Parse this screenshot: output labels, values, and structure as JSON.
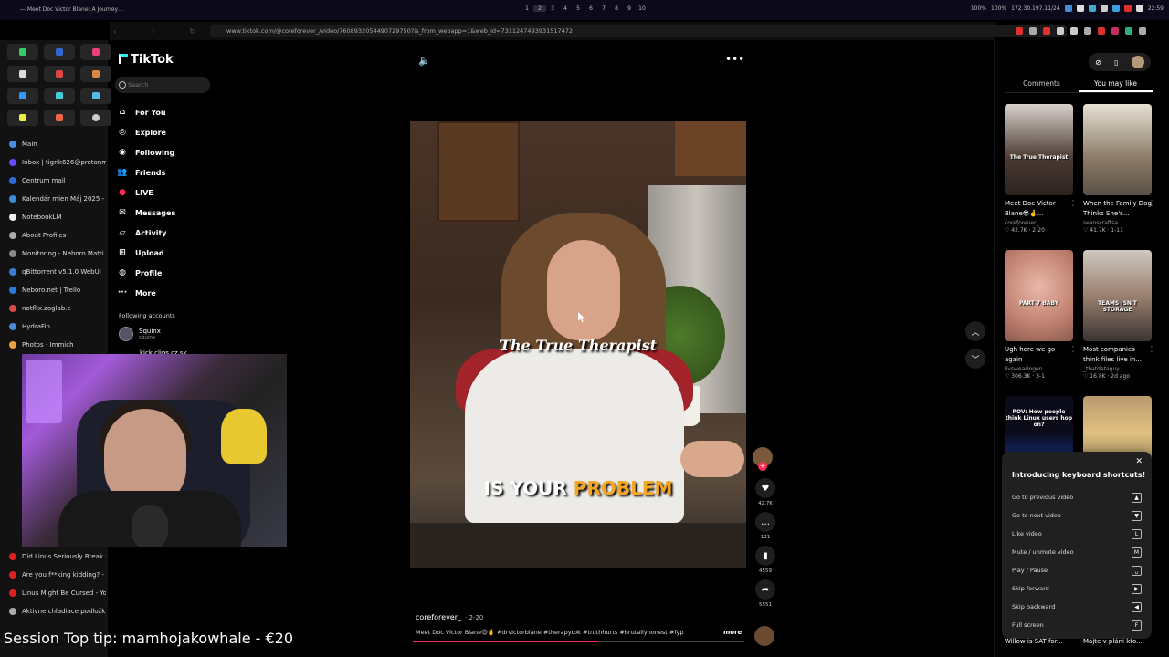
{
  "topbar": {
    "window_title": "— Meet Doc Victor Blane: A Journey…",
    "workspaces": [
      "1",
      "2",
      "3",
      "4",
      "5",
      "6",
      "7",
      "8",
      "9",
      "10"
    ],
    "active_workspace": "2",
    "tray": {
      "volume": "100%",
      "brightness": "100%",
      "ip": "172.30.197.11/24",
      "clock": "22:59"
    }
  },
  "urlbar": {
    "url": "www.tiktok.com/@coreforever_/video/7608932054490729750?is_from_webapp=1&web_id=7311247493931517472"
  },
  "browser_sidebar": {
    "tabs": [
      {
        "label": "Main",
        "color": "#4a90e2"
      },
      {
        "label": "Inbox | tigrik626@protonm…",
        "color": "#6d4aff"
      },
      {
        "label": "Centrum mail",
        "color": "#2a6ad8"
      },
      {
        "label": "Kalendár mien Máj 2025 - …",
        "color": "#3a8ad8"
      },
      {
        "label": "NotebookLM",
        "color": "#eeeeee"
      },
      {
        "label": "About Profiles",
        "color": "#aaaaaa"
      },
      {
        "label": "Monitoring - Neboro Matti…",
        "color": "#888888"
      },
      {
        "label": "qBittorrent v5.1.0 WebUI",
        "color": "#3a7ad8"
      },
      {
        "label": "Neboro.net | Trello",
        "color": "#2a7ad8"
      },
      {
        "label": "notflix.zoglab.e",
        "color": "#d84a4a"
      },
      {
        "label": "HydraFin",
        "color": "#4a8ad8"
      },
      {
        "label": "Photos - Immich",
        "color": "#e8a040"
      }
    ],
    "tabs_bottom": [
      {
        "label": "Did Linus Seriously Break F…",
        "color": "#e02020"
      },
      {
        "label": "Are you f**king kidding? - …",
        "color": "#e02020"
      },
      {
        "label": "Linus Might Be Cursed - Yo…",
        "color": "#e02020"
      },
      {
        "label": "Aktivne chladiace podložky…",
        "color": "#aaaaaa"
      }
    ]
  },
  "stream_overlay": {
    "text": "Session Top tip: mamhojakowhale - €20"
  },
  "tiktok_nav": {
    "logo": "TikTok",
    "search_placeholder": "Search",
    "items": [
      {
        "label": "For You",
        "icon": "home-icon"
      },
      {
        "label": "Explore",
        "icon": "compass-icon"
      },
      {
        "label": "Following",
        "icon": "following-icon"
      },
      {
        "label": "Friends",
        "icon": "friends-icon"
      },
      {
        "label": "LIVE",
        "icon": "live-icon"
      },
      {
        "label": "Messages",
        "icon": "messages-icon"
      },
      {
        "label": "Activity",
        "icon": "activity-icon"
      },
      {
        "label": "Upload",
        "icon": "upload-icon"
      },
      {
        "label": "Profile",
        "icon": "profile-icon"
      },
      {
        "label": "More",
        "icon": "more-icon"
      }
    ],
    "following_header": "Following accounts",
    "following": [
      {
        "name": "Squinx",
        "handle": "squinx"
      },
      {
        "name": "kick clips cz sk"
      }
    ]
  },
  "video": {
    "caption_top": "The True Therapist",
    "caption_bottom_prefix": "IS YOUR ",
    "caption_bottom_highlight": "PROBLEM",
    "author": "coreforever_",
    "date": "· 2-20",
    "description": "Meet Doc Victor Blane😎🤞 #drvictorblane #therapytok #truthhurts #brutallyhonest #fyp",
    "more_label": "more",
    "progress_fraction": 0.56,
    "stats": {
      "likes": "42.7K",
      "comments": "121",
      "saves": "4559",
      "shares": "5551"
    }
  },
  "right_panel": {
    "tabs": [
      "Comments",
      "You may like"
    ],
    "active_tab": "You may like",
    "cards": [
      {
        "title": "Meet Doc Victor Blane😎🤞...",
        "author": "coreforever_",
        "stats": "♡ 42.7K · 2-20",
        "thumb_text": "The True Therapist"
      },
      {
        "title": "When the Family Dog Thinks She's...",
        "author": "seanscraftsa",
        "stats": "♡ 41.7K · 1-11",
        "thumb_text": ""
      },
      {
        "title": "Ugh here we go again",
        "author": "livswearingen",
        "stats": "♡ 306.3K · 3-1",
        "thumb_text": "PART 7 BABY"
      },
      {
        "title": "Most companies think files live in...",
        "author": "_thatdataguy",
        "stats": "♡ 16.8K · 2d ago",
        "thumb_text": "TEAMS ISN'T STORAGE"
      },
      {
        "title": "Willow is SAT for...",
        "author": "",
        "stats": "",
        "thumb_text": "POV: How people think Linux users hop on?"
      },
      {
        "title": "Majte v pláni kto...",
        "author": "",
        "stats": "",
        "thumb_text": ""
      }
    ]
  },
  "shortcuts": {
    "title": "Introducing keyboard shortcuts!",
    "rows": [
      {
        "label": "Go to previous video",
        "key": "▲"
      },
      {
        "label": "Go to next video",
        "key": "▼"
      },
      {
        "label": "Like video",
        "key": "L"
      },
      {
        "label": "Mute / unmute video",
        "key": "M"
      },
      {
        "label": "Play / Pause",
        "key": "␣"
      },
      {
        "label": "Skip forward",
        "key": "▶"
      },
      {
        "label": "Skip backward",
        "key": "◀"
      },
      {
        "label": "Full screen",
        "key": "F"
      }
    ]
  }
}
